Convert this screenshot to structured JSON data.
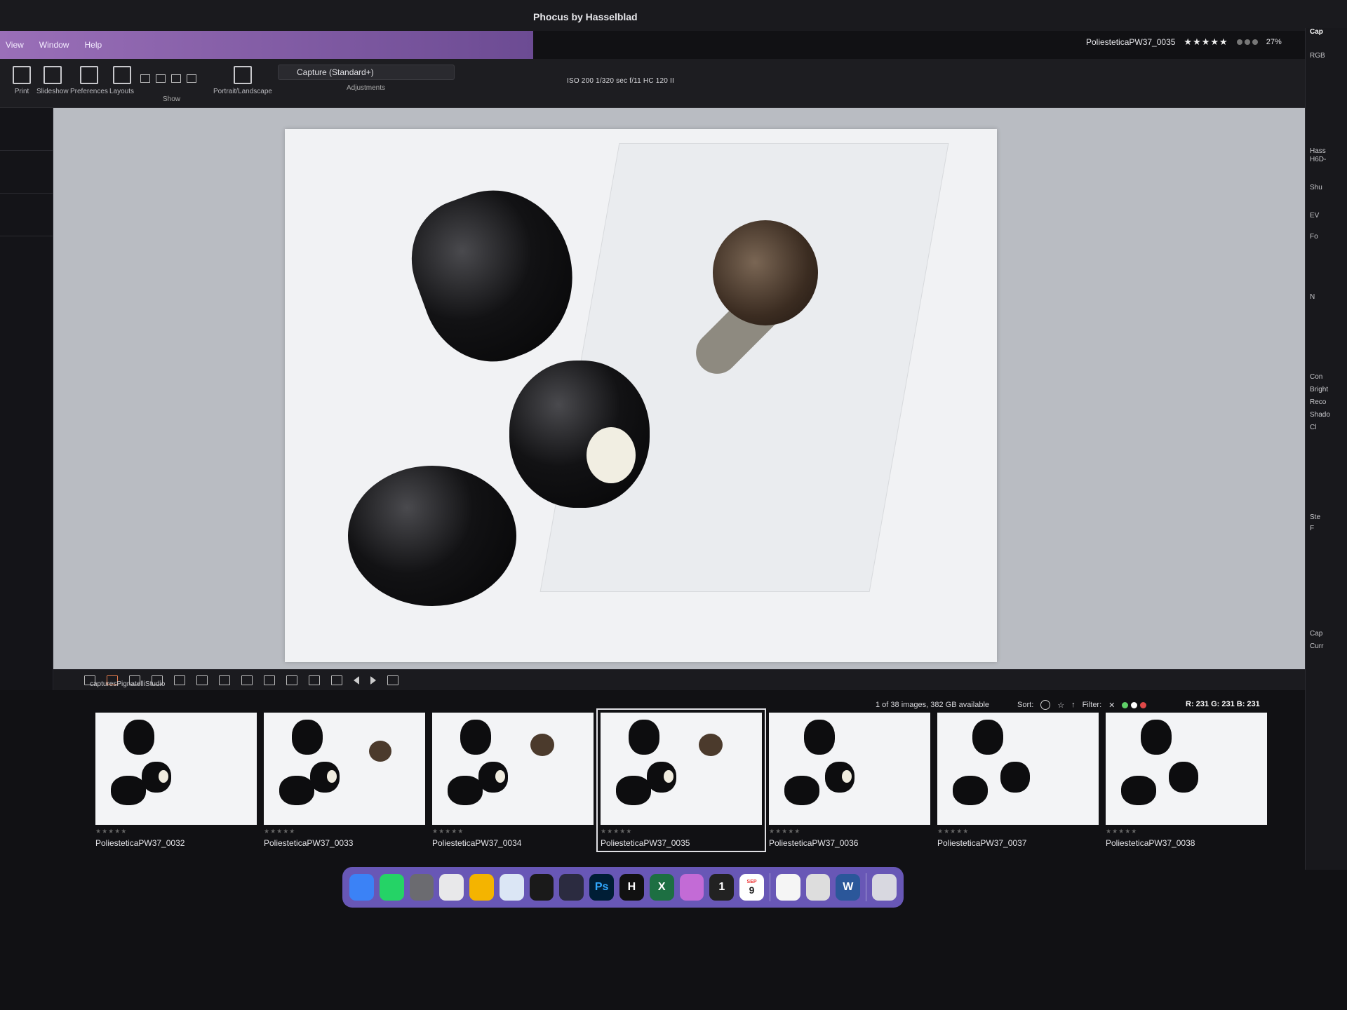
{
  "app": {
    "title": "Phocus by Hasselblad"
  },
  "menu": [
    "View",
    "Window",
    "Help"
  ],
  "toolbar": {
    "tools": [
      {
        "label": "Print",
        "icon": "print-icon"
      },
      {
        "label": "Slideshow",
        "icon": "slideshow-icon"
      },
      {
        "label": "Preferences",
        "icon": "preferences-icon"
      },
      {
        "label": "Layouts",
        "icon": "layouts-icon"
      },
      {
        "label": "Portrait/Landscape",
        "icon": "portrait-landscape-icon"
      }
    ],
    "show_label": "Show",
    "preset": "Capture (Standard+)",
    "adjustments_label": "Adjustments",
    "exif": "ISO 200   1/320 sec   f/11   HC 120 II"
  },
  "fileinfo": {
    "filename": "PoliesteticaPW37_0035",
    "stars": "★★★★★",
    "zoom": "27%"
  },
  "viewer": {
    "folder": "capturesPignatelliStudio"
  },
  "browser": {
    "count": "1 of 38 images, 382 GB available",
    "sort_label": "Sort:",
    "filter_label": "Filter:",
    "rgb": "R: 231   G: 231   B: 231"
  },
  "filmstrip": [
    {
      "name": "PoliesteticaPW37_0032",
      "rating": "★★★★★"
    },
    {
      "name": "PoliesteticaPW37_0033",
      "rating": "★★★★★"
    },
    {
      "name": "PoliesteticaPW37_0034",
      "rating": "★★★★★"
    },
    {
      "name": "PoliesteticaPW37_0035",
      "rating": "★★★★★"
    },
    {
      "name": "PoliesteticaPW37_0036",
      "rating": "★★★★★"
    },
    {
      "name": "PoliesteticaPW37_0037",
      "rating": "★★★★★"
    },
    {
      "name": "PoliesteticaPW37_0038",
      "rating": "★★★★★"
    }
  ],
  "dock": {
    "apps": [
      {
        "name": "finder-icon",
        "label": "",
        "color": "#3b82f6"
      },
      {
        "name": "whatsapp-icon",
        "label": "",
        "color": "#25d366"
      },
      {
        "name": "system-settings-icon",
        "label": "",
        "color": "#6b6b70"
      },
      {
        "name": "textedit-icon",
        "label": "",
        "color": "#e8e8ea"
      },
      {
        "name": "chrome-icon",
        "label": "",
        "color": "#f4b400"
      },
      {
        "name": "preview-icon",
        "label": "",
        "color": "#dbe6f5"
      },
      {
        "name": "activity-monitor-icon",
        "label": "",
        "color": "#1a1a1a"
      },
      {
        "name": "davinci-icon",
        "label": "",
        "color": "#2b2b40"
      },
      {
        "name": "photoshop-icon",
        "label": "Ps",
        "color": "#001e36"
      },
      {
        "name": "hasselblad-icon",
        "label": "H",
        "color": "#111111"
      },
      {
        "name": "excel-icon",
        "label": "X",
        "color": "#1d6f42"
      },
      {
        "name": "folder-icon",
        "label": "",
        "color": "#c36bd6"
      },
      {
        "name": "one-icon",
        "label": "1",
        "color": "#222222"
      },
      {
        "name": "calendar-icon",
        "label": "9",
        "color": "#ffffff"
      },
      {
        "name": "photos-icon",
        "label": "",
        "color": "#f5f5f5"
      },
      {
        "name": "capture-icon",
        "label": "",
        "color": "#dddddd"
      },
      {
        "name": "word-icon",
        "label": "W",
        "color": "#2b579a"
      },
      {
        "name": "trash-icon",
        "label": "",
        "color": "#d8d8e0"
      }
    ],
    "calendar_month": "SEP"
  },
  "rightpanel": {
    "items": [
      "Cap",
      "RGB",
      "Hass",
      "H6D-",
      "Shu",
      "EV",
      "Fo",
      "N",
      "Con",
      "Bright",
      "Reco",
      "Shado",
      "Cl",
      "Ste",
      "F",
      "Cap",
      "Curr"
    ]
  }
}
